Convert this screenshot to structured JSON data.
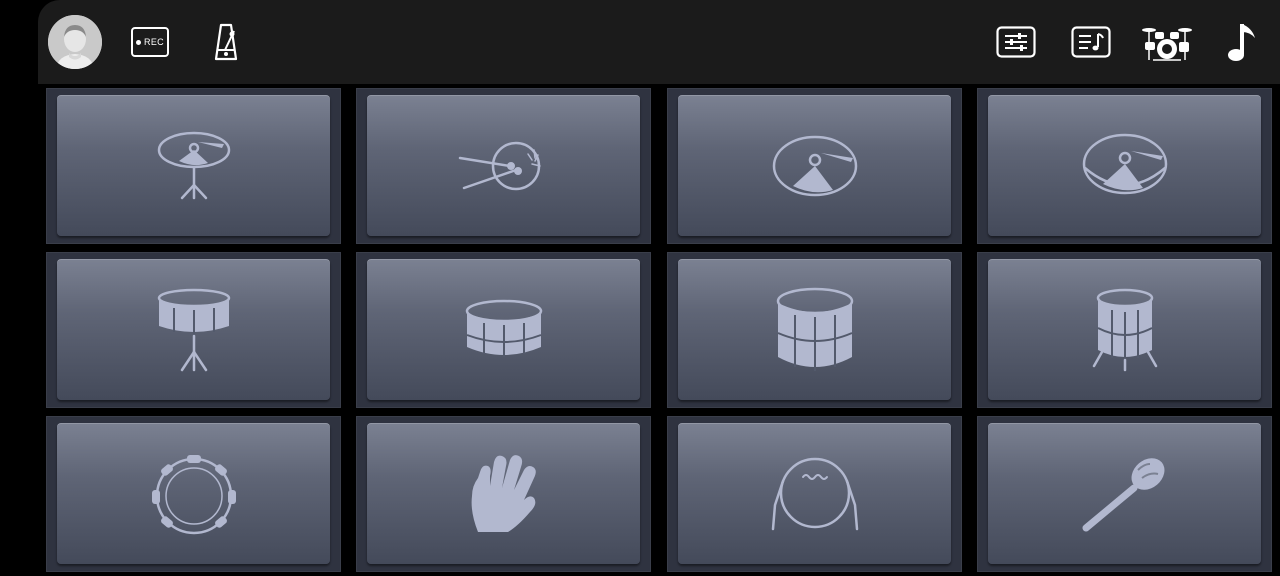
{
  "toolbar": {
    "rec_label": "REC",
    "icons": [
      "avatar",
      "record-icon",
      "metronome-icon",
      "mixer-icon",
      "song-list-icon",
      "drum-kit-icon",
      "music-note-icon"
    ]
  },
  "colors": {
    "topbar": "#1b1b1b",
    "pad_face_top": "#7b8192",
    "pad_face_bottom": "#444a5a",
    "pad_icon": "#b2b8cf",
    "background": "#000000"
  },
  "pads": [
    {
      "row": 1,
      "col": 1,
      "icon": "hihat-icon"
    },
    {
      "row": 1,
      "col": 2,
      "icon": "drumstick-hit-icon"
    },
    {
      "row": 1,
      "col": 3,
      "icon": "crash-cymbal-icon"
    },
    {
      "row": 1,
      "col": 4,
      "icon": "ride-cymbal-icon"
    },
    {
      "row": 2,
      "col": 1,
      "icon": "snare-on-stand-icon"
    },
    {
      "row": 2,
      "col": 2,
      "icon": "snare-drum-icon"
    },
    {
      "row": 2,
      "col": 3,
      "icon": "tom-drum-icon"
    },
    {
      "row": 2,
      "col": 4,
      "icon": "floor-tom-icon"
    },
    {
      "row": 3,
      "col": 1,
      "icon": "tambourine-icon"
    },
    {
      "row": 3,
      "col": 2,
      "icon": "hand-clap-icon"
    },
    {
      "row": 3,
      "col": 3,
      "icon": "hand-drum-icon"
    },
    {
      "row": 3,
      "col": 4,
      "icon": "maraca-icon"
    }
  ]
}
